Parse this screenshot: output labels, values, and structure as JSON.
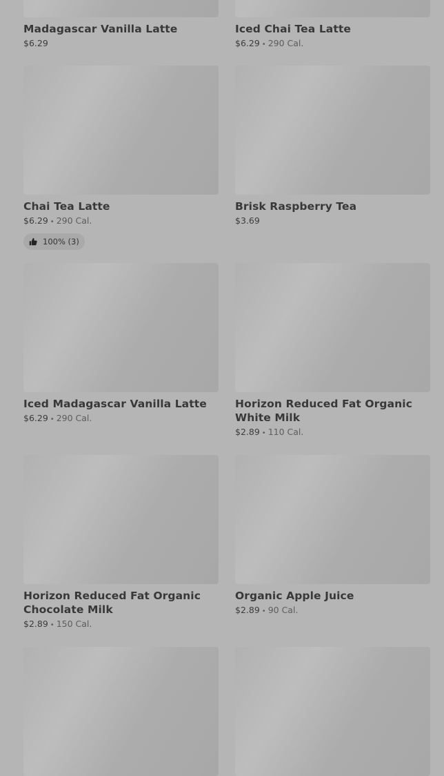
{
  "items": [
    {
      "name": "Madagascar Vanilla Latte",
      "price": "$6.29",
      "sep": "",
      "cal": ""
    },
    {
      "name": "Iced Chai Tea Latte",
      "price": "$6.29",
      "sep": "•",
      "cal": "290 Cal."
    },
    {
      "name": "Chai Tea Latte",
      "price": "$6.29",
      "sep": "•",
      "cal": "290 Cal.",
      "rating": "100% (3)"
    },
    {
      "name": "Brisk Raspberry Tea",
      "price": "$3.69",
      "sep": "",
      "cal": ""
    },
    {
      "name": "Iced Madagascar Vanilla Latte",
      "price": "$6.29",
      "sep": "•",
      "cal": "290 Cal."
    },
    {
      "name": "Horizon Reduced Fat Organic White Milk",
      "price": "$2.89",
      "sep": "•",
      "cal": "110 Cal."
    },
    {
      "name": "Horizon Reduced Fat Organic Chocolate Milk",
      "price": "$2.89",
      "sep": "•",
      "cal": "150 Cal."
    },
    {
      "name": "Organic Apple Juice",
      "price": "$2.89",
      "sep": "•",
      "cal": "90 Cal."
    }
  ]
}
